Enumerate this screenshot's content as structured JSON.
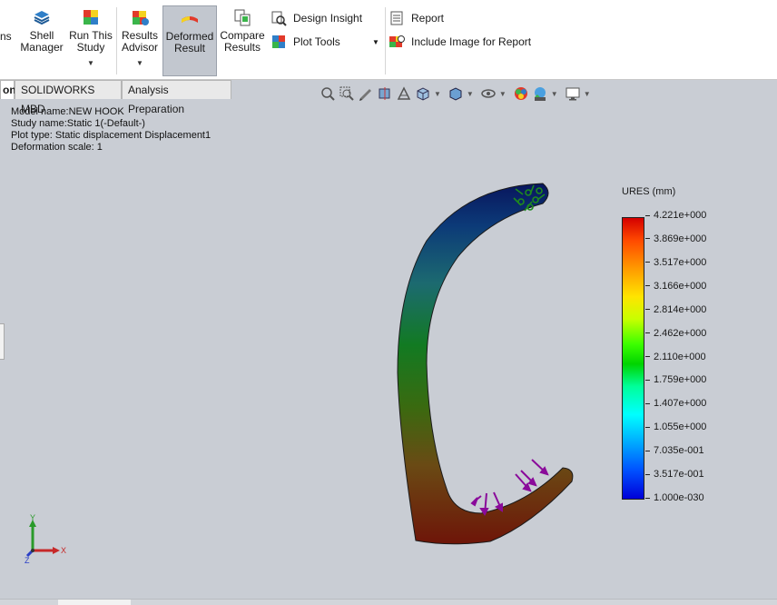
{
  "ribbon": {
    "cut_label": "ns",
    "shell_manager": "Shell\nManager",
    "run_study_line1": "Run This",
    "run_study_line2": "Study",
    "results_advisor_line1": "Results",
    "results_advisor_line2": "Advisor",
    "deformed_result_line1": "Deformed",
    "deformed_result_line2": "Result",
    "compare_results_line1": "Compare",
    "compare_results_line2": "Results",
    "design_insight": "Design Insight",
    "plot_tools": "Plot Tools",
    "report": "Report",
    "include_image": "Include Image for Report"
  },
  "tabs": {
    "first_tab": "on",
    "mbd_tab": "SOLIDWORKS MBD",
    "analysis_tab": "Analysis Preparation"
  },
  "info": {
    "model_name": "Model name:NEW HOOK",
    "study_name": "Study name:Static 1(-Default-)",
    "plot_type": "Plot type: Static displacement Displacement1",
    "deformation_scale": "Deformation scale: 1"
  },
  "legend": {
    "title": "URES (mm)",
    "ticks": [
      "4.221e+000",
      "3.869e+000",
      "3.517e+000",
      "3.166e+000",
      "2.814e+000",
      "2.462e+000",
      "2.110e+000",
      "1.759e+000",
      "1.407e+000",
      "1.055e+000",
      "7.035e-001",
      "3.517e-001",
      "1.000e-030"
    ]
  },
  "triad": {
    "x": "X",
    "y": "Y",
    "z": "Z"
  },
  "icons": [
    "shell-manager-icon",
    "run-study-icon",
    "results-advisor-icon",
    "deformed-result-icon",
    "compare-results-icon",
    "design-insight-icon",
    "plot-tools-icon",
    "report-icon",
    "include-image-icon"
  ],
  "colors": {
    "accent": "#c2c7cf",
    "viewport": "#c9cdd4",
    "ribbon": "#ffffff"
  }
}
